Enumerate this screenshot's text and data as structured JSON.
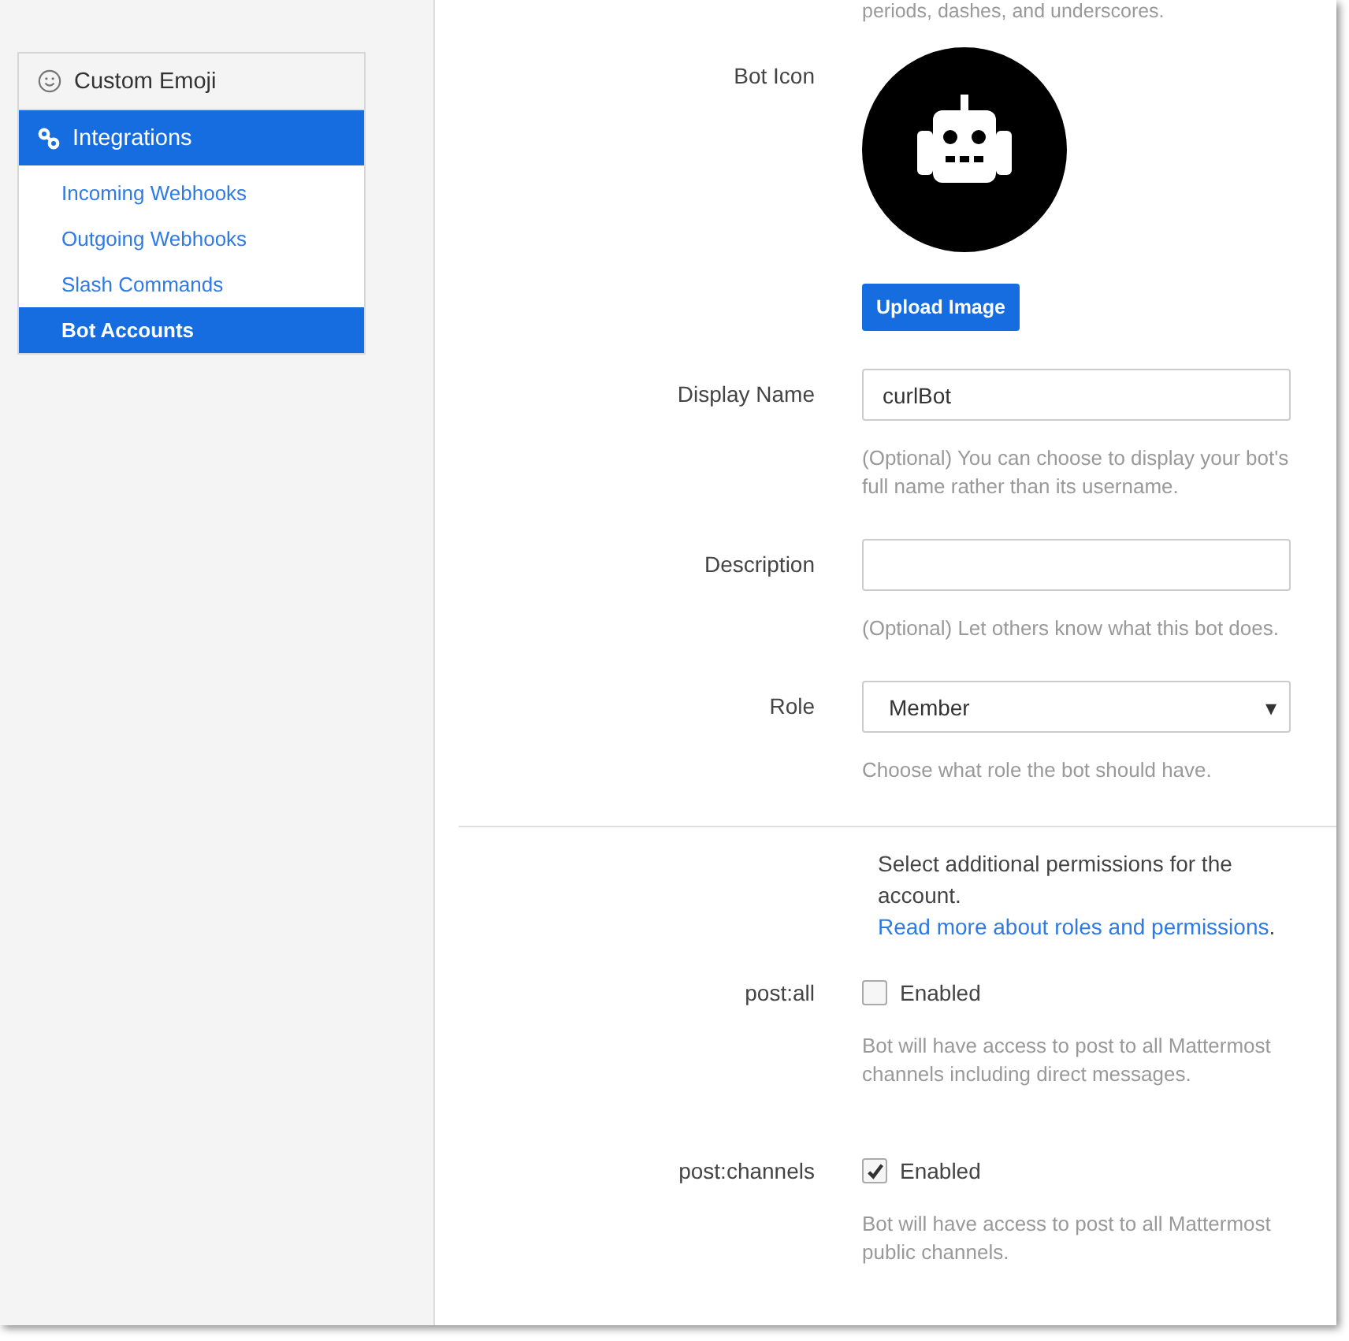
{
  "sidebar": {
    "items": [
      {
        "label": "Custom Emoji",
        "selected": false
      },
      {
        "label": "Integrations",
        "selected": true,
        "children": [
          {
            "label": "Incoming Webhooks",
            "selected": false
          },
          {
            "label": "Outgoing Webhooks",
            "selected": false
          },
          {
            "label": "Slash Commands",
            "selected": false
          },
          {
            "label": "Bot Accounts",
            "selected": true
          }
        ]
      }
    ]
  },
  "form": {
    "top_hint": "periods, dashes, and underscores.",
    "bot_icon": {
      "label": "Bot Icon",
      "button": "Upload Image"
    },
    "fields": [
      {
        "kind": "text",
        "label": "Display Name",
        "value": "curlBot",
        "help": "(Optional) You can choose to display your bot's full name rather than its username."
      },
      {
        "kind": "text",
        "label": "Description",
        "help": "(Optional) Let others know what this bot does."
      },
      {
        "kind": "select",
        "label": "Role",
        "value": "Member",
        "caret": "▾",
        "help": "Choose what role the bot should have."
      }
    ],
    "permissions_intro": {
      "text": "Select additional permissions for the account. ",
      "link": "Read more about roles and permissions",
      "end": "."
    },
    "permissions": [
      {
        "label": "post:all",
        "option": "Enabled",
        "checked": false,
        "help": "Bot will have access to post to all Mattermost channels including direct messages."
      },
      {
        "label": "post:channels",
        "option": "Enabled",
        "checked": true,
        "help": "Bot will have access to post to all Mattermost public channels."
      }
    ]
  }
}
